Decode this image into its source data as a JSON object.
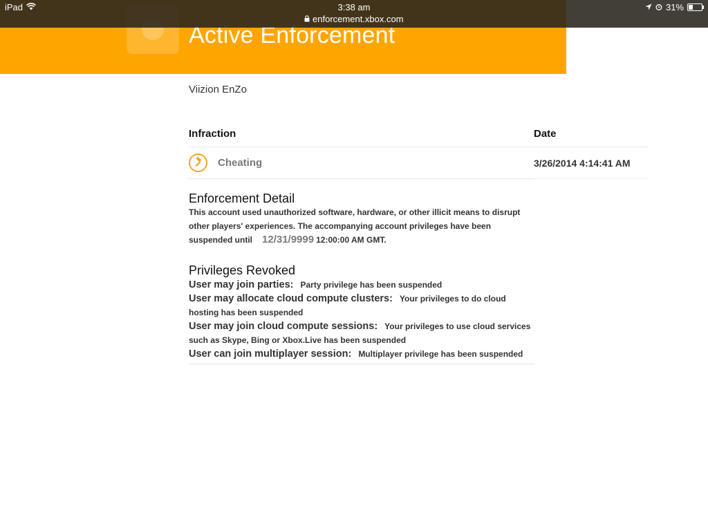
{
  "status_bar": {
    "device": "iPad",
    "time": "3:38 am",
    "url": "enforcement.xbox.com",
    "battery": "31%"
  },
  "header": {
    "title": "Active Enforcement"
  },
  "account": {
    "gamertag": "Viizion EnZo"
  },
  "table": {
    "columns": [
      "Infraction",
      "Date"
    ],
    "rows": [
      {
        "infraction": "Cheating",
        "date": "3/26/2014 4:14:41 AM",
        "icon": "gavel-icon"
      }
    ]
  },
  "enforcement_detail": {
    "heading": "Enforcement Detail",
    "text": "This account used unauthorized software, hardware, or other illicit means to disrupt other players' experiences. The accompanying account privileges have been suspended until",
    "until_date": "12/31/9999",
    "until_time": "12:00:00 AM GMT."
  },
  "privileges": {
    "heading": "Privileges Revoked",
    "items": [
      {
        "name": "User may join parties:",
        "desc": "Party privilege has been suspended"
      },
      {
        "name": "User may allocate cloud compute clusters:",
        "desc": "Your privileges to do cloud hosting has been suspended"
      },
      {
        "name": "User may join cloud compute sessions:",
        "desc": "Your privileges to use cloud services such as Skype, Bing or Xbox.Live has been suspended"
      },
      {
        "name": "User can join multiplayer session:",
        "desc": "Multiplayer privilege has been suspended"
      }
    ]
  },
  "colors": {
    "banner": "#ffa500",
    "accent": "#f5a623"
  }
}
